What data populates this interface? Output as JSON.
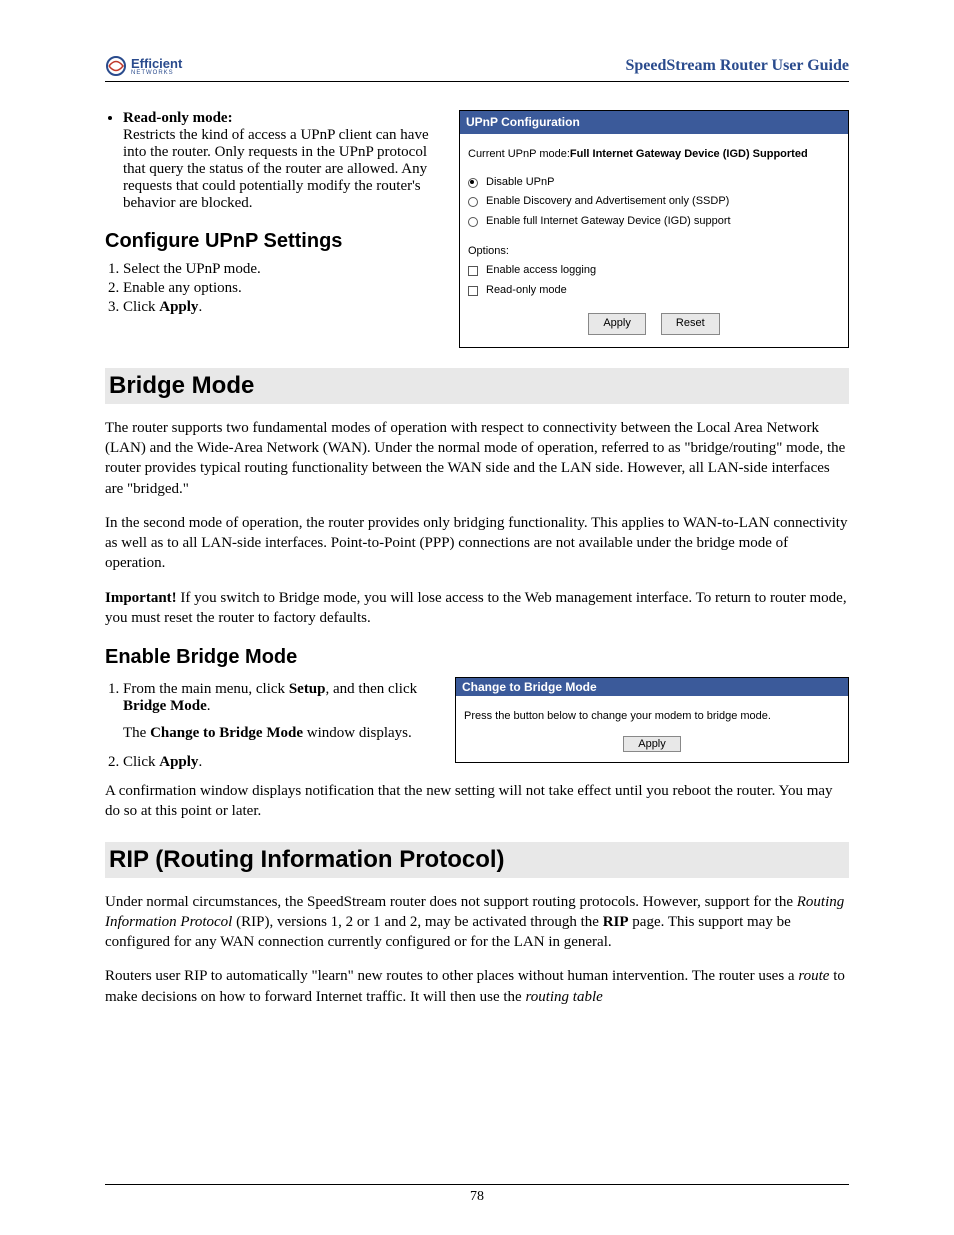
{
  "header": {
    "logo_name": "Efficient",
    "logo_sub": "NETWORKS",
    "guide_title": "SpeedStream Router User Guide"
  },
  "readonly": {
    "heading": "Read-only mode:",
    "text": "Restricts the kind of access a UPnP client can have into the router. Only requests in the UPnP protocol that query the status of the router are allowed. Any requests that could potentially modify the router's behavior are blocked."
  },
  "configure": {
    "heading": "Configure UPnP Settings",
    "steps": {
      "s1": "Select the UPnP mode.",
      "s2": "Enable any options.",
      "s3_pre": "Click ",
      "s3_bold": "Apply",
      "s3_post": "."
    }
  },
  "upnp_ui": {
    "title": "UPnP Configuration",
    "current_pre": "Current UPnP mode: ",
    "current_bold": "Full Internet Gateway Device (IGD) Supported",
    "radio1": "Disable UPnP",
    "radio2": "Enable Discovery and Advertisement only (SSDP)",
    "radio3": "Enable full Internet Gateway Device (IGD) support",
    "options_label": "Options:",
    "opt1": "Enable access logging",
    "opt2": "Read-only mode",
    "apply": "Apply",
    "reset": "Reset"
  },
  "bridge": {
    "heading": "Bridge Mode",
    "p1": "The router supports two fundamental modes of operation with respect to connectivity between the Local Area Network (LAN) and the Wide-Area Network (WAN). Under the normal mode of operation, referred to as \"bridge/routing\" mode, the router provides typical routing functionality between the WAN side and the LAN side. However, all LAN-side interfaces are \"bridged.\"",
    "p2": "In the second mode of operation, the router provides only bridging functionality. This applies to WAN-to-LAN connectivity as well as to all LAN-side interfaces. Point-to-Point (PPP) connections are not available under the bridge mode of operation.",
    "p3_bold": "Important!",
    "p3_rest": "  If you switch to Bridge mode, you will lose access to the Web management interface. To return to router mode, you must reset the router to factory defaults."
  },
  "enable_bridge": {
    "heading": "Enable Bridge Mode",
    "s1_pre": "From the main menu, click ",
    "s1_b1": "Setup",
    "s1_mid": ", and then click ",
    "s1_b2": "Bridge Mode",
    "s1_post": ".",
    "s1_sub_pre": "The ",
    "s1_sub_b": "Change to Bridge Mode",
    "s1_sub_post": " window displays.",
    "s2_pre": "Click ",
    "s2_b": "Apply",
    "s2_post": ".",
    "s2_sub": "A confirmation window displays notification that the new setting will not take effect until you reboot the router. You may do so at this point or later."
  },
  "bridge_ui": {
    "title": "Change to Bridge Mode",
    "text": "Press the button below to change your modem to bridge mode.",
    "apply": "Apply"
  },
  "rip": {
    "heading": "RIP (Routing Information Protocol)",
    "p1_a": "Under normal circumstances, the SpeedStream router does not support routing protocols. However, support for the ",
    "p1_i": "Routing Information Protocol",
    "p1_b": " (RIP), versions 1, 2 or 1 and 2, may be activated through the ",
    "p1_bold": "RIP",
    "p1_c": " page. This support may be configured for any WAN connection currently configured or for the LAN in general.",
    "p2_a": "Routers user RIP to automatically \"learn\" new routes to other places without human intervention. The router uses a ",
    "p2_i1": "route",
    "p2_b": " to make decisions on how to forward Internet traffic. It will then use the ",
    "p2_i2": "routing table"
  },
  "page_number": "78"
}
